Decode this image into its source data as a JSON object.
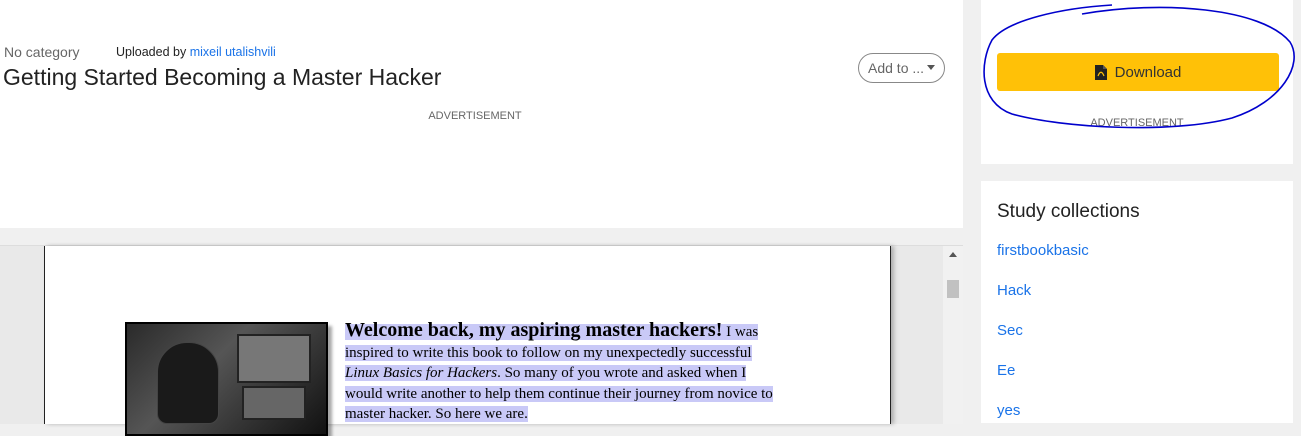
{
  "header": {
    "category": "No category",
    "uploaded_prefix": "Uploaded by",
    "uploader": "mixeil utalishvili",
    "title": "Getting Started Becoming a Master Hacker",
    "add_to_label": "Add to ...",
    "ad_label": "ADVERTISEMENT"
  },
  "document": {
    "lead": "Welcome back, my aspiring master hackers!",
    "line1_rest": " I was",
    "line2": "inspired to write this book to follow on my unexpectedly successful",
    "line3_italic": "Linux Basics for Hackers",
    "line3_rest": ". So many of you wrote and asked when I",
    "line4": "would write another to help them continue their journey from novice to",
    "line5": "master hacker. So here we are."
  },
  "sidebar": {
    "download_label": "Download",
    "ad_label": "ADVERTISEMENT",
    "collections_title": "Study collections",
    "collections": [
      "firstbookbasic",
      "Hack",
      "Sec",
      "Ee",
      "yes"
    ]
  },
  "colors": {
    "download": "#ffc107",
    "link": "#1a73e8",
    "highlight": "#c9c9f7",
    "annotation": "#0000cc"
  }
}
